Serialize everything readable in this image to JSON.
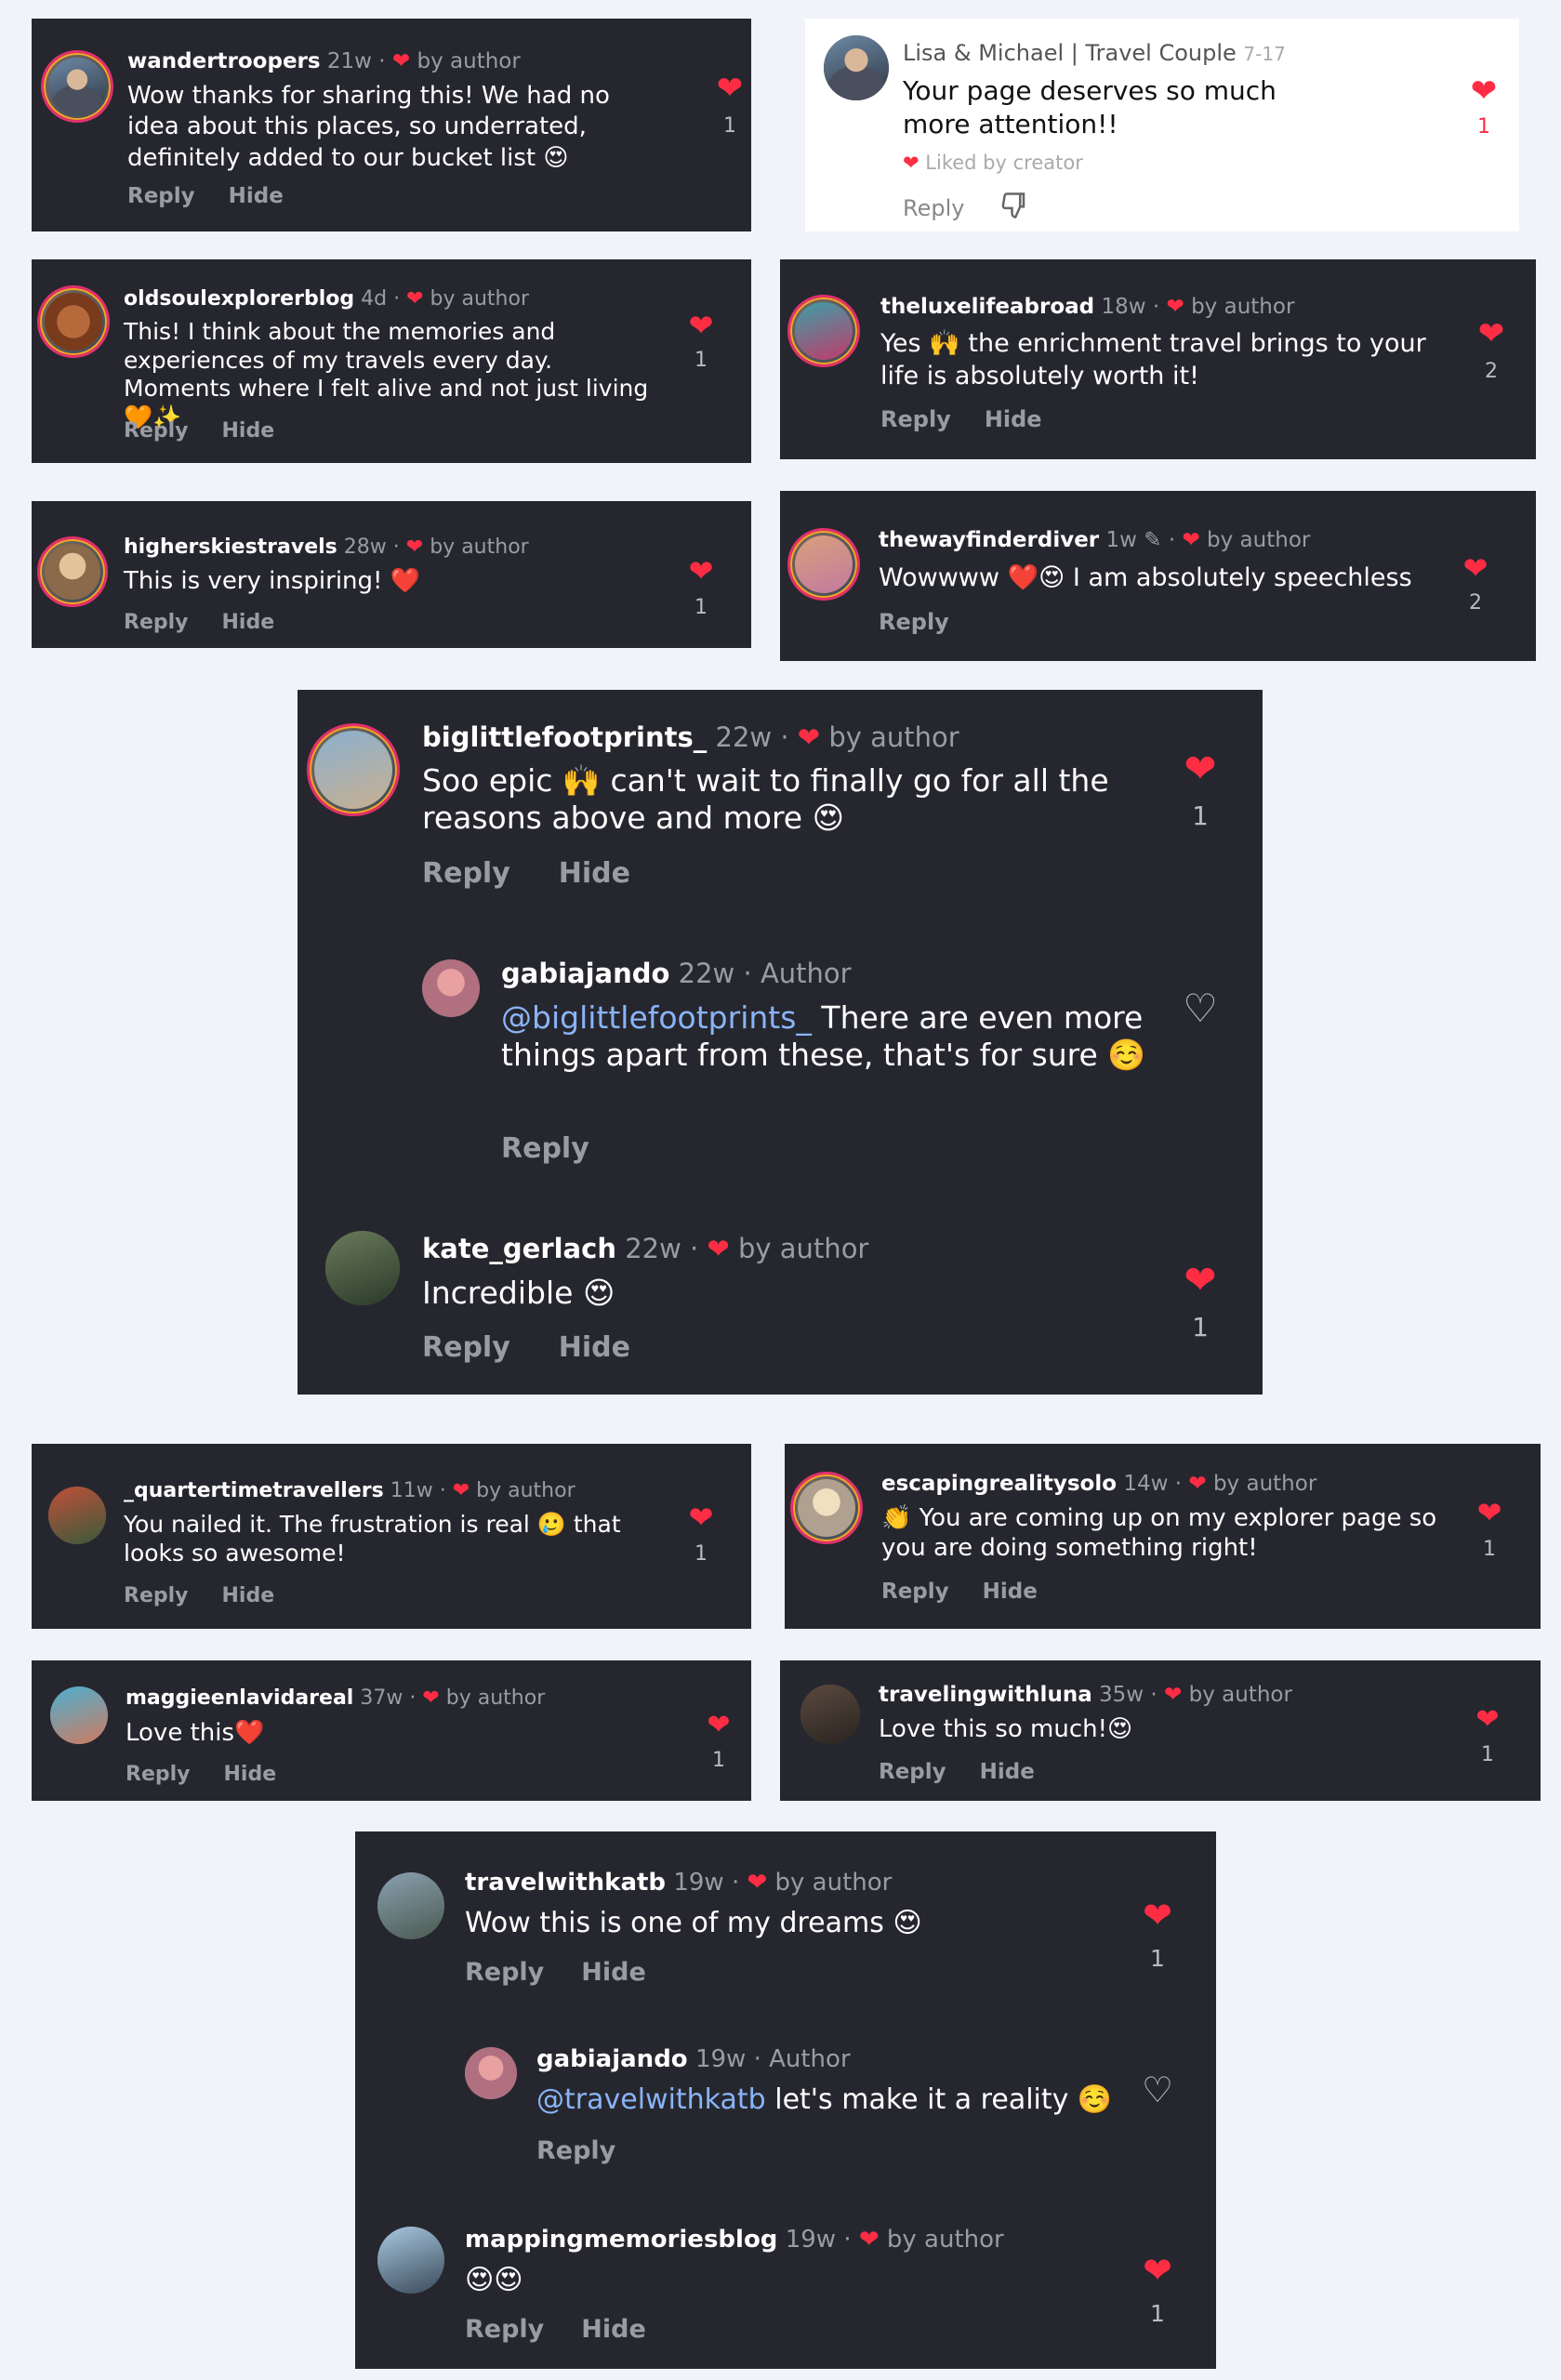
{
  "comments": {
    "c1": {
      "user": "wandertroopers",
      "time": "21w",
      "by": "by author",
      "text": "Wow thanks for sharing this! We had no idea about this places, so underrated, definitely added to our bucket list 😍",
      "reply": "Reply",
      "hide": "Hide",
      "likes": "1"
    },
    "c2": {
      "user": "Lisa & Michael | Travel Couple",
      "time": "7-17",
      "text": "Your page deserves so much more attention!!",
      "liked_by": "Liked by creator",
      "reply": "Reply",
      "likes": "1"
    },
    "c3": {
      "user": "oldsoulexplorerblog",
      "time": "4d",
      "by": "by author",
      "text": "This! I think about the memories and experiences of my travels every day. Moments where I felt alive and not just living 🧡✨",
      "reply": "Reply",
      "hide": "Hide",
      "likes": "1"
    },
    "c4": {
      "user": "theluxelifeabroad",
      "time": "18w",
      "by": "by author",
      "text": "Yes 🙌 the enrichment travel brings to your life is absolutely worth it!",
      "reply": "Reply",
      "hide": "Hide",
      "likes": "2"
    },
    "c5": {
      "user": "higherskiestravels",
      "time": "28w",
      "by": "by author",
      "text": "This is very inspiring! ❤️",
      "reply": "Reply",
      "hide": "Hide",
      "likes": "1"
    },
    "c6": {
      "user": "thewayfinderdiver",
      "time": "1w",
      "by": "by author",
      "text": "Wowwww ❤️😍 I am absolutely speechless",
      "reply": "Reply",
      "likes": "2"
    },
    "c7": {
      "user": "biglittlefootprints_",
      "time": "22w",
      "by": "by author",
      "text": "Soo epic 🙌 can't wait to finally go for all the reasons above and more 😍",
      "reply": "Reply",
      "hide": "Hide",
      "likes": "1"
    },
    "c7r": {
      "user": "gabiajando",
      "time": "22w",
      "author": "Author",
      "mention": "@biglittlefootprints_",
      "text": " There are even more things apart from these, that's for sure ☺️",
      "reply": "Reply"
    },
    "c8": {
      "user": "kate_gerlach",
      "time": "22w",
      "by": "by author",
      "text": "Incredible 😍",
      "reply": "Reply",
      "hide": "Hide",
      "likes": "1"
    },
    "c9": {
      "user": "_quartertimetravellers",
      "time": "11w",
      "by": "by author",
      "text": "You nailed it. The frustration is real 🥲 that looks so awesome!",
      "reply": "Reply",
      "hide": "Hide",
      "likes": "1"
    },
    "c10": {
      "user": "escapingrealitysolo",
      "time": "14w",
      "by": "by author",
      "text": "👏 You are coming up on my explorer page so you are doing something right!",
      "reply": "Reply",
      "hide": "Hide",
      "likes": "1"
    },
    "c11": {
      "user": "maggieenlavidareal",
      "time": "37w",
      "by": "by author",
      "text": "Love this❤️",
      "reply": "Reply",
      "hide": "Hide",
      "likes": "1"
    },
    "c12": {
      "user": "travelingwithluna",
      "time": "35w",
      "by": "by author",
      "text": "Love this so much!😍",
      "reply": "Reply",
      "hide": "Hide",
      "likes": "1"
    },
    "c13": {
      "user": "travelwithkatb",
      "time": "19w",
      "by": "by author",
      "text": "Wow this is one of my dreams 😍",
      "reply": "Reply",
      "hide": "Hide",
      "likes": "1"
    },
    "c13r": {
      "user": "gabiajando",
      "time": "19w",
      "author": "Author",
      "mention": "@travelwithkatb",
      "text": " let's make it a reality ☺️",
      "reply": "Reply"
    },
    "c14": {
      "user": "mappingmemoriesblog",
      "time": "19w",
      "by": "by author",
      "text": "😍😍",
      "reply": "Reply",
      "hide": "Hide",
      "likes": "1"
    }
  },
  "icons": {
    "heart": "heart-icon",
    "heart_outline": "heart-outline-icon",
    "dislike": "thumbs-down-icon",
    "pin": "pin-icon"
  },
  "colors": {
    "card": "#26272e",
    "heart": "#ff2d44",
    "muted": "#9a9ca3",
    "mention": "#8ab4f8"
  }
}
